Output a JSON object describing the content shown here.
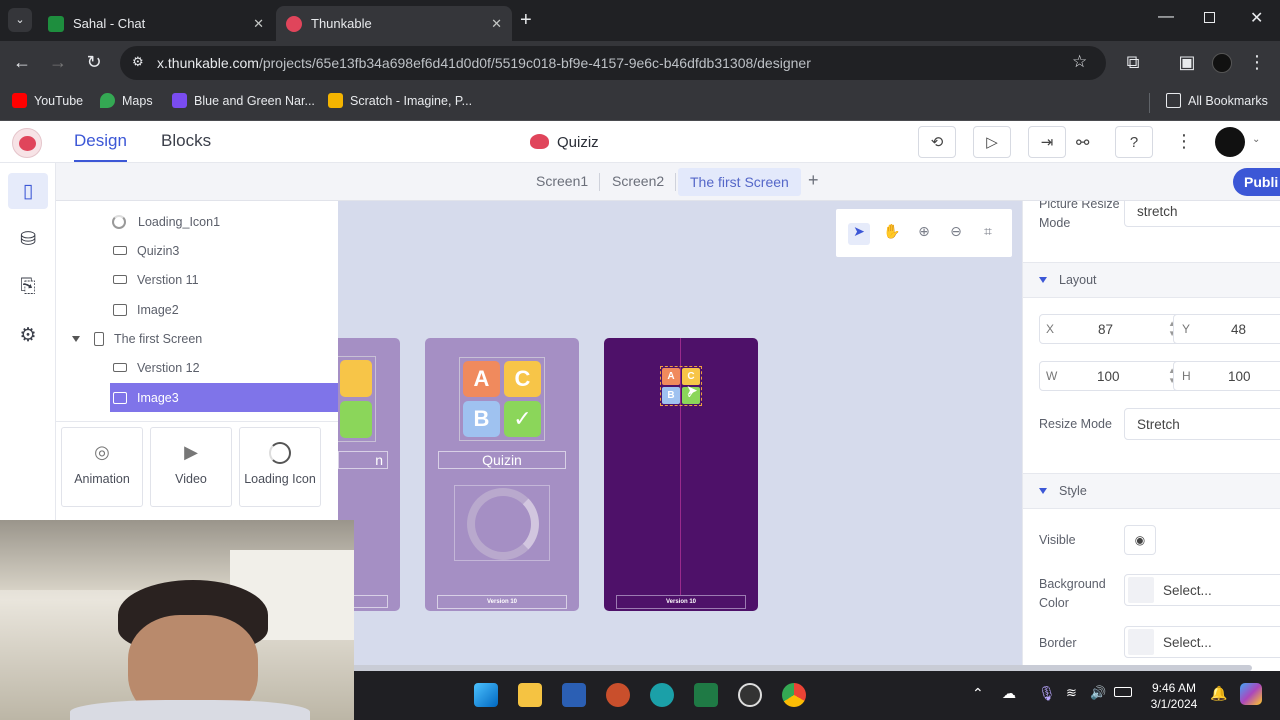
{
  "browser": {
    "tabs": [
      {
        "label": "Sahal - Chat",
        "active": false
      },
      {
        "label": "Thunkable",
        "active": true
      }
    ],
    "url_host": "x.thunkable.com",
    "url_path": "/projects/65e13fb34a698ef6d41d0d0f/5519c018-bf9e-4157-9e6c-b46dfdb31308/designer",
    "bookmarks": [
      "YouTube",
      "Maps",
      "Blue and Green Nar...",
      "Scratch - Imagine, P..."
    ],
    "all_bookmarks": "All Bookmarks"
  },
  "app": {
    "tabs": {
      "design": "Design",
      "blocks": "Blocks"
    },
    "project_title": "Quiziz",
    "publish": "Publi",
    "screens": [
      "Screen1",
      "Screen2",
      "The first Screen"
    ],
    "add_screen": "+",
    "tree": [
      {
        "label": "Loading_Icon1",
        "icon": "loading-icon"
      },
      {
        "label": "Quizin3",
        "icon": "button-icon"
      },
      {
        "label": "Verstion 11",
        "icon": "button-icon"
      },
      {
        "label": "Image2",
        "icon": "image-icon"
      },
      {
        "label": "The first Screen",
        "icon": "screen-icon"
      },
      {
        "label": "Verstion 12",
        "icon": "button-icon"
      },
      {
        "label": "Image3",
        "icon": "image-icon",
        "selected": true
      }
    ],
    "palette": [
      "Animation",
      "Video",
      "Loading Icon"
    ],
    "canvas": {
      "phone1_label": "n",
      "phone2_label": "Quizin",
      "phone2_version": "Version 10",
      "phone3_version": "Version 10",
      "tiles": [
        "A",
        "C",
        "B",
        "✓"
      ]
    },
    "props": {
      "picture_resize_label": "Picture Resize Mode",
      "picture_resize_value": "stretch",
      "layout_section": "Layout",
      "x_label": "X",
      "x_value": "87",
      "y_label": "Y",
      "y_value": "48",
      "w_label": "W",
      "w_value": "100",
      "h_label": "H",
      "h_value": "100",
      "resize_mode_label": "Resize Mode",
      "resize_mode_value": "Stretch",
      "style_section": "Style",
      "visible_label": "Visible",
      "bg_color_label": "Background Color",
      "bg_color_value": "Select...",
      "border_label": "Border",
      "border_value": "Select..."
    }
  },
  "taskbar": {
    "time": "9:46 AM",
    "date": "3/1/2024"
  },
  "colors": {
    "accent": "#3c57d6",
    "selected_row": "#7f74e9",
    "phone_light": "#a58fc4",
    "phone_dark": "#4e1169",
    "canvas_bg": "#d6dbec"
  }
}
